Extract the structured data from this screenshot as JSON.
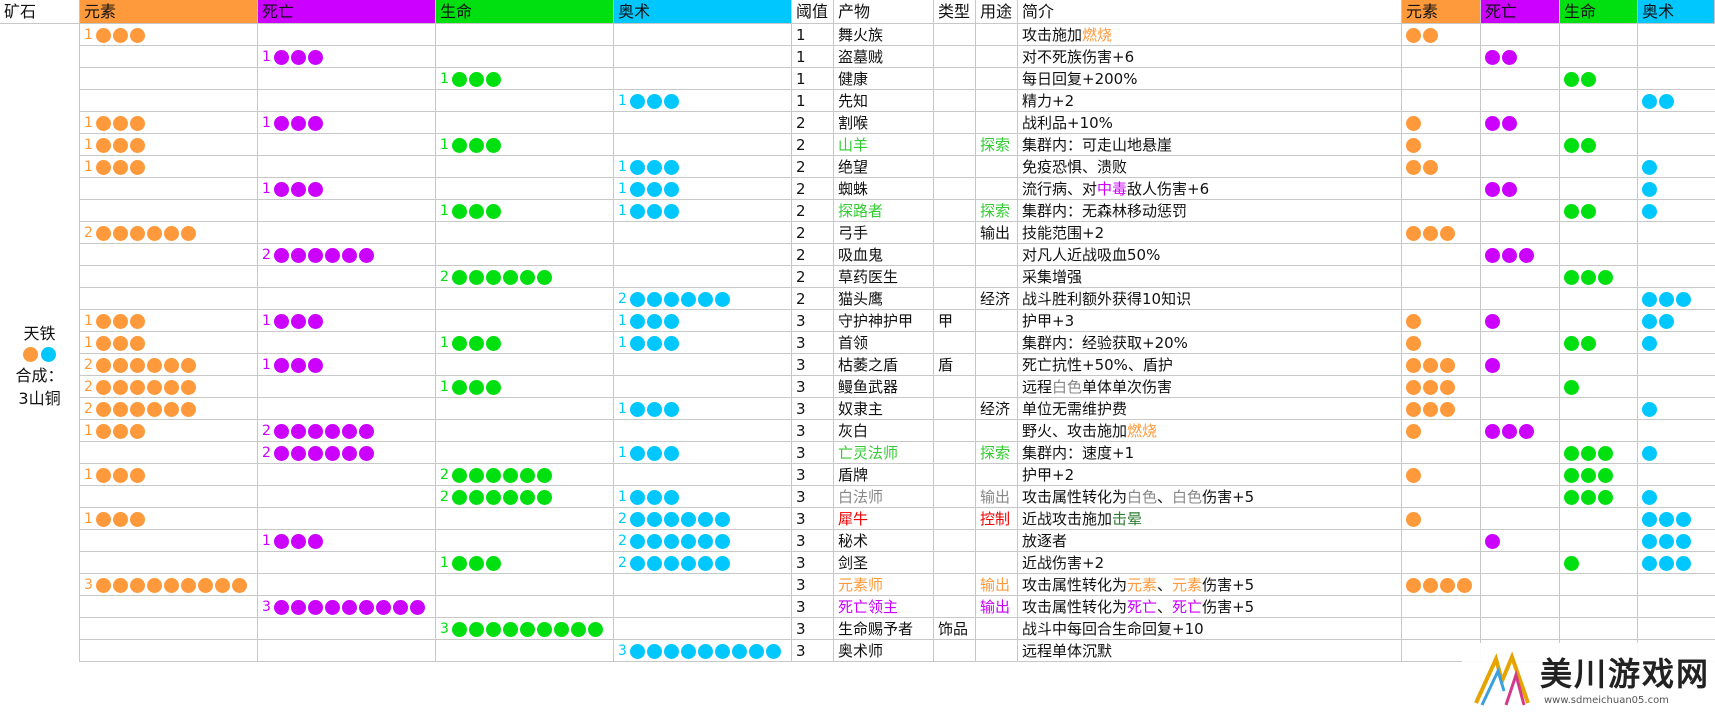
{
  "colors": {
    "element": "#ff9a3c",
    "death": "#cc00ff",
    "life": "#00e010",
    "arcane": "#00c8ff",
    "explore": "#33cc33",
    "red": "#ee0000",
    "gray": "#888888",
    "stun": "#2e7d32"
  },
  "headers": {
    "ore": "矿石",
    "element": "元素",
    "death": "死亡",
    "life": "生命",
    "arcane": "奥术",
    "threshold": "阈值",
    "product": "产物",
    "type": "类型",
    "use": "用途",
    "desc": "简介",
    "r_element": "元素",
    "r_death": "死亡",
    "r_life": "生命",
    "r_arcane": "奥术"
  },
  "ore": {
    "name": "天铁",
    "dots": [
      "element",
      "arcane"
    ],
    "synth_label": "合成：",
    "synth_value": "3山铜"
  },
  "rows": [
    {
      "e": 1,
      "d": 0,
      "l": 0,
      "a": 0,
      "t": "1",
      "name": "舞火族",
      "nc": "",
      "type": "",
      "use": "",
      "uc": "",
      "desc": [
        [
          "攻击施加",
          ""
        ],
        [
          "燃烧",
          "element"
        ]
      ],
      "re": 2,
      "rd": 0,
      "rl": 0,
      "ra": 0
    },
    {
      "e": 0,
      "d": 1,
      "l": 0,
      "a": 0,
      "t": "1",
      "name": "盗墓贼",
      "nc": "",
      "type": "",
      "use": "",
      "uc": "",
      "desc": [
        [
          "对不死族伤害+6",
          ""
        ]
      ],
      "re": 0,
      "rd": 2,
      "rl": 0,
      "ra": 0
    },
    {
      "e": 0,
      "d": 0,
      "l": 1,
      "a": 0,
      "t": "1",
      "name": "健康",
      "nc": "",
      "type": "",
      "use": "",
      "uc": "",
      "desc": [
        [
          "每日回复+200%",
          ""
        ]
      ],
      "re": 0,
      "rd": 0,
      "rl": 2,
      "ra": 0
    },
    {
      "e": 0,
      "d": 0,
      "l": 0,
      "a": 1,
      "t": "1",
      "name": "先知",
      "nc": "",
      "type": "",
      "use": "",
      "uc": "",
      "desc": [
        [
          "精力+2",
          ""
        ]
      ],
      "re": 0,
      "rd": 0,
      "rl": 0,
      "ra": 2
    },
    {
      "e": 1,
      "d": 1,
      "l": 0,
      "a": 0,
      "t": "2",
      "name": "割喉",
      "nc": "",
      "type": "",
      "use": "",
      "uc": "",
      "desc": [
        [
          "战利品+10%",
          ""
        ]
      ],
      "re": 1,
      "rd": 2,
      "rl": 0,
      "ra": 0
    },
    {
      "e": 1,
      "d": 0,
      "l": 1,
      "a": 0,
      "t": "2",
      "name": "山羊",
      "nc": "explore",
      "type": "",
      "use": "探索",
      "uc": "explore",
      "desc": [
        [
          "集群内：可走山地悬崖",
          ""
        ]
      ],
      "re": 1,
      "rd": 0,
      "rl": 2,
      "ra": 0
    },
    {
      "e": 1,
      "d": 0,
      "l": 0,
      "a": 1,
      "t": "2",
      "name": "绝望",
      "nc": "",
      "type": "",
      "use": "",
      "uc": "",
      "desc": [
        [
          "免疫恐惧、溃败",
          ""
        ]
      ],
      "re": 2,
      "rd": 0,
      "rl": 0,
      "ra": 1
    },
    {
      "e": 0,
      "d": 1,
      "l": 0,
      "a": 1,
      "t": "2",
      "name": "蜘蛛",
      "nc": "",
      "type": "",
      "use": "",
      "uc": "",
      "desc": [
        [
          "流行病、对",
          ""
        ],
        [
          "中毒",
          "death"
        ],
        [
          "敌人伤害+6",
          ""
        ]
      ],
      "re": 0,
      "rd": 2,
      "rl": 0,
      "ra": 1
    },
    {
      "e": 0,
      "d": 0,
      "l": 1,
      "a": 1,
      "t": "2",
      "name": "探路者",
      "nc": "explore",
      "type": "",
      "use": "探索",
      "uc": "explore",
      "desc": [
        [
          "集群内：无森林移动惩罚",
          ""
        ]
      ],
      "re": 0,
      "rd": 0,
      "rl": 2,
      "ra": 1
    },
    {
      "e": 2,
      "d": 0,
      "l": 0,
      "a": 0,
      "t": "2",
      "name": "弓手",
      "nc": "",
      "type": "",
      "use": "输出",
      "uc": "",
      "desc": [
        [
          "技能范围+2",
          ""
        ]
      ],
      "re": 3,
      "rd": 0,
      "rl": 0,
      "ra": 0
    },
    {
      "e": 0,
      "d": 2,
      "l": 0,
      "a": 0,
      "t": "2",
      "name": "吸血鬼",
      "nc": "",
      "type": "",
      "use": "",
      "uc": "",
      "desc": [
        [
          "对凡人近战吸血50%",
          ""
        ]
      ],
      "re": 0,
      "rd": 3,
      "rl": 0,
      "ra": 0
    },
    {
      "e": 0,
      "d": 0,
      "l": 2,
      "a": 0,
      "t": "2",
      "name": "草药医生",
      "nc": "",
      "type": "",
      "use": "",
      "uc": "",
      "desc": [
        [
          "采集增强",
          ""
        ]
      ],
      "re": 0,
      "rd": 0,
      "rl": 3,
      "ra": 0
    },
    {
      "e": 0,
      "d": 0,
      "l": 0,
      "a": 2,
      "t": "2",
      "name": "猫头鹰",
      "nc": "",
      "type": "",
      "use": "经济",
      "uc": "",
      "desc": [
        [
          "战斗胜利额外获得10知识",
          ""
        ]
      ],
      "re": 0,
      "rd": 0,
      "rl": 0,
      "ra": 3
    },
    {
      "e": 1,
      "d": 1,
      "l": 0,
      "a": 1,
      "t": "3",
      "name": "守护神护甲",
      "nc": "",
      "type": "甲",
      "use": "",
      "uc": "",
      "desc": [
        [
          "护甲+3",
          ""
        ]
      ],
      "re": 1,
      "rd": 1,
      "rl": 0,
      "ra": 2
    },
    {
      "e": 1,
      "d": 0,
      "l": 1,
      "a": 1,
      "t": "3",
      "name": "首领",
      "nc": "",
      "type": "",
      "use": "",
      "uc": "",
      "desc": [
        [
          "集群内：经验获取+20%",
          ""
        ]
      ],
      "re": 1,
      "rd": 0,
      "rl": 2,
      "ra": 1
    },
    {
      "e": 2,
      "d": 1,
      "l": 0,
      "a": 0,
      "t": "3",
      "name": "枯萎之盾",
      "nc": "",
      "type": "盾",
      "use": "",
      "uc": "",
      "desc": [
        [
          "死亡抗性+50%、盾护",
          ""
        ]
      ],
      "re": 3,
      "rd": 1,
      "rl": 0,
      "ra": 0
    },
    {
      "e": 2,
      "d": 0,
      "l": 1,
      "a": 0,
      "t": "3",
      "name": "鳗鱼武器",
      "nc": "",
      "type": "",
      "use": "",
      "uc": "",
      "desc": [
        [
          "远程",
          ""
        ],
        [
          "白色",
          "gray"
        ],
        [
          "单体单次伤害",
          ""
        ]
      ],
      "re": 3,
      "rd": 0,
      "rl": 1,
      "ra": 0
    },
    {
      "e": 2,
      "d": 0,
      "l": 0,
      "a": 1,
      "t": "3",
      "name": "奴隶主",
      "nc": "",
      "type": "",
      "use": "经济",
      "uc": "",
      "desc": [
        [
          "单位无需维护费",
          ""
        ]
      ],
      "re": 3,
      "rd": 0,
      "rl": 0,
      "ra": 1
    },
    {
      "e": 1,
      "d": 2,
      "l": 0,
      "a": 0,
      "t": "3",
      "name": "灰白",
      "nc": "",
      "type": "",
      "use": "",
      "uc": "",
      "desc": [
        [
          "野火、攻击施加",
          ""
        ],
        [
          "燃烧",
          "element"
        ]
      ],
      "re": 1,
      "rd": 3,
      "rl": 0,
      "ra": 0
    },
    {
      "e": 0,
      "d": 2,
      "l": 0,
      "a": 1,
      "t": "3",
      "name": "亡灵法师",
      "nc": "explore",
      "type": "",
      "use": "探索",
      "uc": "explore",
      "desc": [
        [
          "集群内：速度+1",
          ""
        ]
      ],
      "re": 0,
      "rd": 0,
      "rl": 3,
      "ra": 1
    },
    {
      "e": 1,
      "d": 0,
      "l": 2,
      "a": 0,
      "t": "3",
      "name": "盾牌",
      "nc": "",
      "type": "",
      "use": "",
      "uc": "",
      "desc": [
        [
          "护甲+2",
          ""
        ]
      ],
      "re": 1,
      "rd": 0,
      "rl": 3,
      "ra": 0
    },
    {
      "e": 0,
      "d": 0,
      "l": 2,
      "a": 1,
      "t": "3",
      "name": "白法师",
      "nc": "gray",
      "type": "",
      "use": "输出",
      "uc": "gray",
      "desc": [
        [
          "攻击属性转化为",
          ""
        ],
        [
          "白色",
          "gray"
        ],
        [
          "、",
          ""
        ],
        [
          "白色",
          "gray"
        ],
        [
          "伤害+5",
          ""
        ]
      ],
      "re": 0,
      "rd": 0,
      "rl": 3,
      "ra": 1
    },
    {
      "e": 1,
      "d": 0,
      "l": 0,
      "a": 2,
      "t": "3",
      "name": "犀牛",
      "nc": "red",
      "type": "",
      "use": "控制",
      "uc": "red",
      "desc": [
        [
          "近战攻击施加",
          ""
        ],
        [
          "击晕",
          "stun"
        ]
      ],
      "re": 1,
      "rd": 0,
      "rl": 0,
      "ra": 3
    },
    {
      "e": 0,
      "d": 1,
      "l": 0,
      "a": 2,
      "t": "3",
      "name": "秘术",
      "nc": "",
      "type": "",
      "use": "",
      "uc": "",
      "desc": [
        [
          "放逐者",
          ""
        ]
      ],
      "re": 0,
      "rd": 1,
      "rl": 0,
      "ra": 3
    },
    {
      "e": 0,
      "d": 0,
      "l": 1,
      "a": 2,
      "t": "3",
      "name": "剑圣",
      "nc": "",
      "type": "",
      "use": "",
      "uc": "",
      "desc": [
        [
          "近战伤害+2",
          ""
        ]
      ],
      "re": 0,
      "rd": 0,
      "rl": 1,
      "ra": 3
    },
    {
      "e": 3,
      "d": 0,
      "l": 0,
      "a": 0,
      "t": "3",
      "name": "元素师",
      "nc": "element",
      "type": "",
      "use": "输出",
      "uc": "element",
      "desc": [
        [
          "攻击属性转化为",
          ""
        ],
        [
          "元素",
          "element"
        ],
        [
          "、",
          ""
        ],
        [
          "元素",
          "element"
        ],
        [
          "伤害+5",
          ""
        ]
      ],
      "re": 4,
      "rd": 0,
      "rl": 0,
      "ra": 0
    },
    {
      "e": 0,
      "d": 3,
      "l": 0,
      "a": 0,
      "t": "3",
      "name": "死亡领主",
      "nc": "death",
      "type": "",
      "use": "输出",
      "uc": "death",
      "desc": [
        [
          "攻击属性转化为",
          ""
        ],
        [
          "死亡",
          "death"
        ],
        [
          "、",
          ""
        ],
        [
          "死亡",
          "death"
        ],
        [
          "伤害+5",
          ""
        ]
      ],
      "re": 0,
      "rd": 0,
      "rl": 0,
      "ra": 0
    },
    {
      "e": 0,
      "d": 0,
      "l": 3,
      "a": 0,
      "t": "3",
      "name": "生命赐予者",
      "nc": "",
      "type": "饰品",
      "use": "",
      "uc": "",
      "desc": [
        [
          "战斗中每回合生命回复+10",
          ""
        ]
      ],
      "re": 0,
      "rd": 0,
      "rl": 0,
      "ra": 0
    },
    {
      "e": 0,
      "d": 0,
      "l": 0,
      "a": 3,
      "t": "3",
      "name": "奥术师",
      "nc": "",
      "type": "",
      "use": "",
      "uc": "",
      "desc": [
        [
          "远程单体沉默",
          ""
        ]
      ],
      "re": 0,
      "rd": 0,
      "rl": 0,
      "ra": 0
    }
  ],
  "watermark": {
    "title": "美川游戏网",
    "url": "www.sdmeichuan05.com"
  }
}
